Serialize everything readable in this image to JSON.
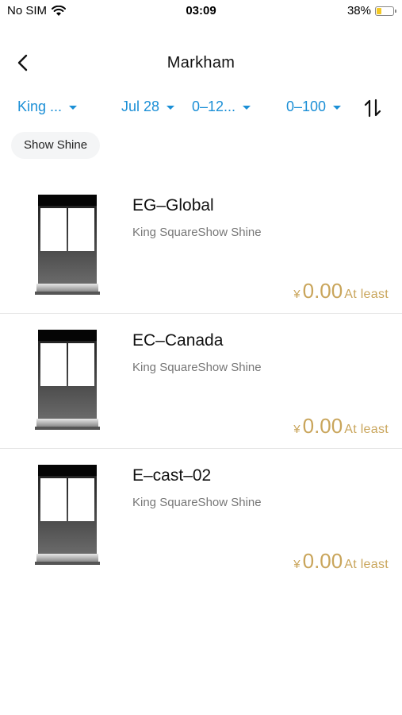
{
  "status": {
    "carrier": "No SIM",
    "time": "03:09",
    "battery_pct": "38%",
    "battery_level": 0.38
  },
  "nav": {
    "title": "Markham",
    "back_icon": "chevron-left-icon"
  },
  "filters": [
    {
      "label": "King ..."
    },
    {
      "label": "Jul 28"
    },
    {
      "label": "0–12..."
    },
    {
      "label": "0–100"
    }
  ],
  "sort_icon": "sort-arrows-icon",
  "chip": {
    "label": "Show Shine"
  },
  "colors": {
    "accent": "#1b8fd6",
    "price": "#c9a55b",
    "battery": "#f3c824"
  },
  "listings": [
    {
      "title": "EG–Global",
      "subtitle": "King SquareShow Shine",
      "currency": "¥",
      "price": "0.00",
      "price_suffix": "At least"
    },
    {
      "title": "EC–Canada",
      "subtitle": "King SquareShow Shine",
      "currency": "¥",
      "price": "0.00",
      "price_suffix": "At least"
    },
    {
      "title": "E–cast–02",
      "subtitle": "King SquareShow Shine",
      "currency": "¥",
      "price": "0.00",
      "price_suffix": "At least"
    }
  ]
}
